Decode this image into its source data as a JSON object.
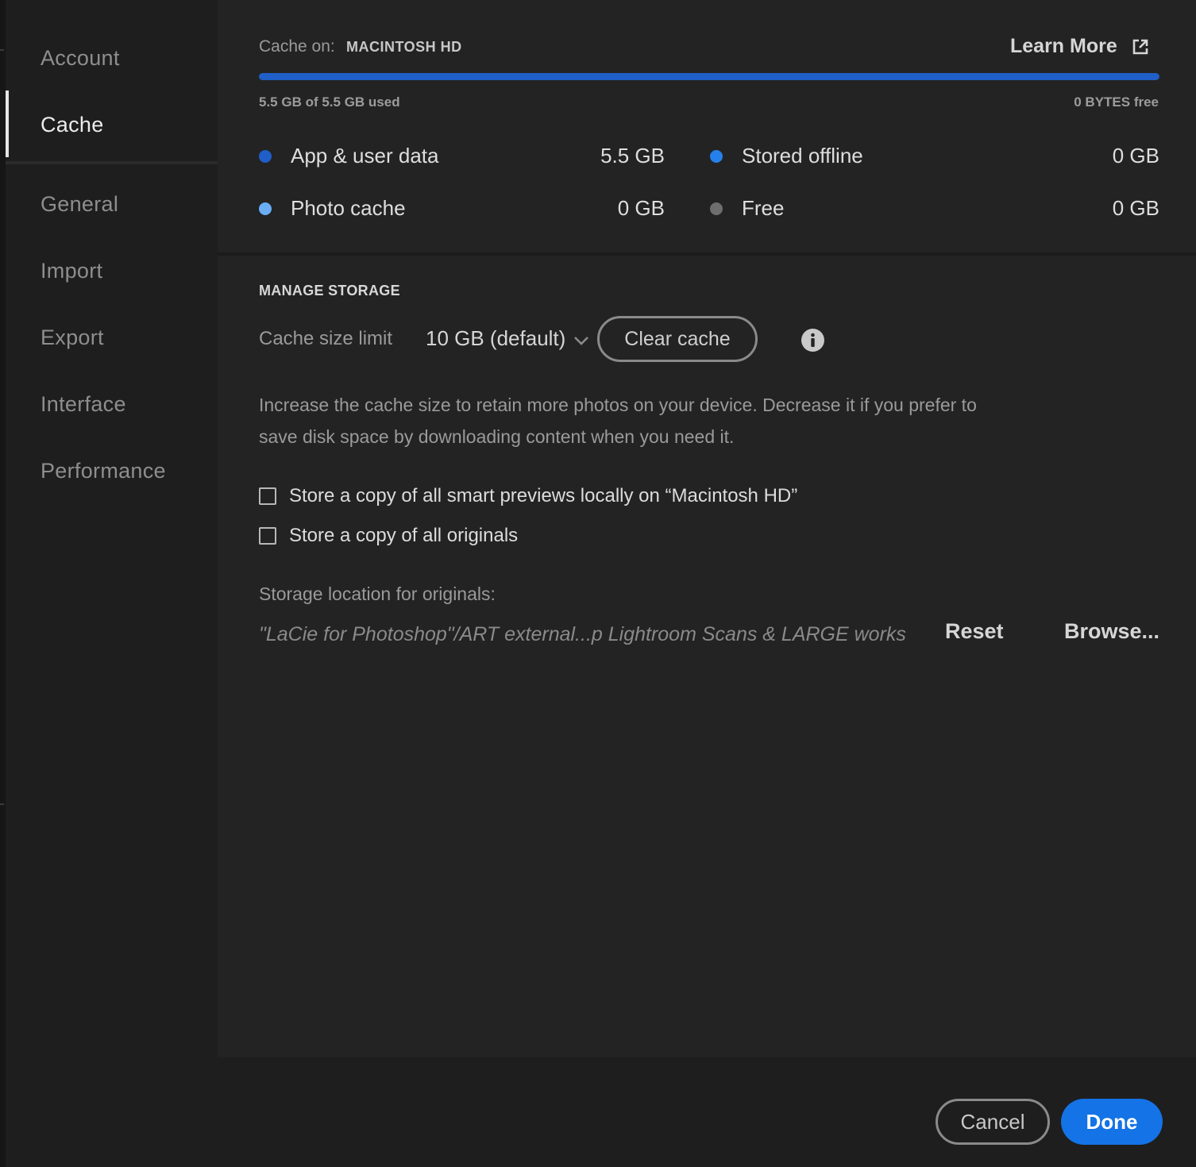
{
  "sidebar": {
    "items": [
      {
        "label": "Account",
        "active": false
      },
      {
        "label": "Cache",
        "active": true
      },
      {
        "label": "General",
        "active": false
      },
      {
        "label": "Import",
        "active": false
      },
      {
        "label": "Export",
        "active": false
      },
      {
        "label": "Interface",
        "active": false
      },
      {
        "label": "Performance",
        "active": false
      }
    ]
  },
  "cache": {
    "cache_on_label": "Cache on:",
    "cache_on_value": "MACINTOSH HD",
    "learn_more": "Learn More",
    "used_fraction": 1.0,
    "used_text": "5.5 GB of 5.5 GB used",
    "free_text": "0 BYTES free",
    "legend": [
      {
        "label": "App & user data",
        "value": "5.5 GB",
        "color": "#1f5fc7"
      },
      {
        "label": "Stored offline",
        "value": "0 GB",
        "color": "#2680eb"
      },
      {
        "label": "Photo cache",
        "value": "0 GB",
        "color": "#6aaef5"
      },
      {
        "label": "Free",
        "value": "0 GB",
        "color": "#6e6e6e"
      }
    ]
  },
  "manage": {
    "title": "MANAGE STORAGE",
    "cache_size_label": "Cache size limit",
    "cache_size_value": "10 GB (default)",
    "clear_cache": "Clear cache",
    "description": "Increase the cache size to retain more photos on your device. Decrease it if you prefer to save disk space by downloading content when you need it.",
    "checkbox_smart_previews": "Store a copy of all smart previews locally on “Macintosh HD”",
    "checkbox_originals": "Store a copy of all originals",
    "storage_location_label": "Storage location for originals:",
    "storage_path": "\"LaCie for Photoshop\"/ART external...p Lightroom Scans & LARGE works",
    "reset": "Reset",
    "browse": "Browse..."
  },
  "footer": {
    "cancel": "Cancel",
    "done": "Done"
  },
  "colors": {
    "accent": "#1473e6",
    "background": "#1e1e1e",
    "panel": "#232323"
  }
}
